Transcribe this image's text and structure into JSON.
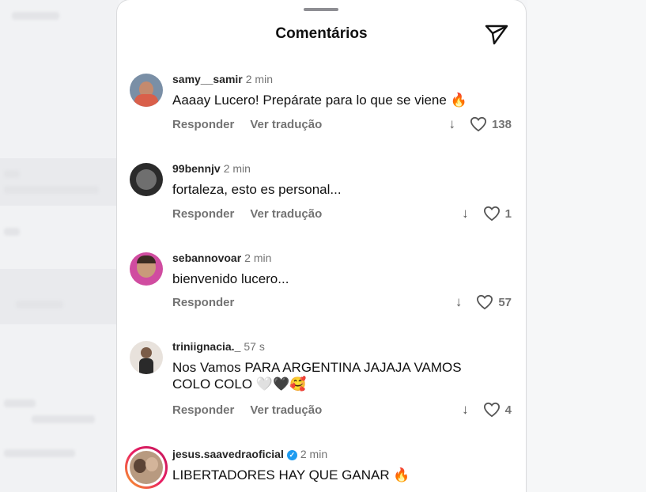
{
  "sheet": {
    "title": "Comentários"
  },
  "comments": [
    {
      "username": "samy__samir",
      "time": "2 min",
      "text": "Aaaay Lucero! Prepárate para lo que se viene 🔥",
      "reply": "Responder",
      "translate": "Ver tradução",
      "likes": "138",
      "verified": false
    },
    {
      "username": "99bennjv",
      "time": "2 min",
      "text": "fortaleza, esto es personal...",
      "reply": "Responder",
      "translate": "Ver tradução",
      "likes": "1",
      "verified": false
    },
    {
      "username": "sebannovoar",
      "time": "2 min",
      "text": "bienvenido lucero...",
      "reply": "Responder",
      "translate": "",
      "likes": "57",
      "verified": false
    },
    {
      "username": "triniignacia._",
      "time": "57 s",
      "text_line1": "Nos Vamos PARA ARGENTINA JAJAJA VAMOS",
      "text_line2": "COLO COLO 🤍🖤🥰",
      "reply": "Responder",
      "translate": "Ver tradução",
      "likes": "4",
      "verified": false
    },
    {
      "username": "jesus.saavedraoficial",
      "time": "2 min",
      "text": "LIBERTADORES HAY QUE GANAR 🔥",
      "verified": true
    }
  ],
  "icons": {
    "send": "paper-plane-icon",
    "like": "heart-icon",
    "dislike": "down-arrow-icon",
    "verified": "verified-badge-icon"
  },
  "colors": {
    "text": "#111111",
    "meta": "#737373",
    "verified": "#1d9bf0"
  }
}
